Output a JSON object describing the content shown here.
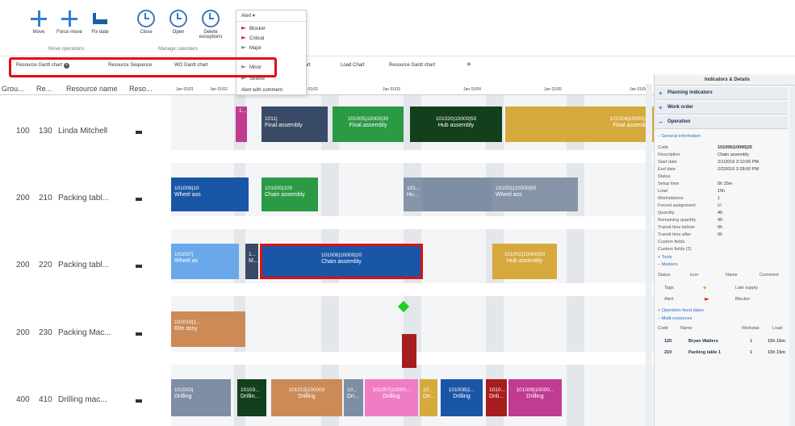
{
  "ribbon": {
    "buttons": [
      {
        "label": "Move",
        "icon": "move-icon"
      },
      {
        "label": "Force move",
        "icon": "force-move-icon"
      },
      {
        "label": "Fix date",
        "icon": "fix-date-icon"
      },
      {
        "label": "Close",
        "icon": "clock-icon"
      },
      {
        "label": "Open",
        "icon": "clock-icon"
      },
      {
        "label": "Delete exceptions",
        "icon": "clock-icon"
      }
    ],
    "groups": [
      "Move operations",
      "Manage calendars"
    ]
  },
  "alert_dropdown": {
    "header": "Alert",
    "items": [
      "Blocker",
      "Critical",
      "Major",
      "Minor",
      "Severe"
    ],
    "footer": "Alert with comment"
  },
  "tabs": [
    "Resource Gantt chart",
    "Resource Sequence",
    "WO Gantt chart",
    "Chart",
    "Load Chart",
    "Resource Gantt chart"
  ],
  "grid_header": {
    "group": "Grou...",
    "resource": "Re...",
    "resource_name": "Resource name",
    "reso": "Reso..."
  },
  "dates": [
    "Jan 01/01",
    "Jan 01/02",
    "Jan 01/02",
    "Jan 01/03",
    "Jan 01/04",
    "Jan 01/05",
    "Jan 01/06"
  ],
  "rows": [
    {
      "group": "100",
      "resource": "130",
      "name": "Linda Mitchell"
    },
    {
      "group": "200",
      "resource": "210",
      "name": "Packing tabl..."
    },
    {
      "group": "200",
      "resource": "220",
      "name": "Packing tabl..."
    },
    {
      "group": "200",
      "resource": "230",
      "name": "Packing Mac..."
    },
    {
      "group": "400",
      "resource": "410",
      "name": "Drilling mac..."
    }
  ],
  "bars": {
    "r0": [
      {
        "id": "1...",
        "label": ""
      },
      {
        "id": "1011|",
        "label": "Final assembly"
      },
      {
        "id": "101005|10000|30",
        "label": "Final assembly"
      },
      {
        "id": "101020|10000|50",
        "label": "Hub assembly"
      },
      {
        "id": "101004|10000|30",
        "label": "Final assembly"
      }
    ],
    "r1": [
      {
        "id": "101006|10",
        "label": "Wheel ass"
      },
      {
        "id": "101005|100",
        "label": "Chain assembly"
      },
      {
        "id": "101...",
        "label": "Hu..."
      },
      {
        "id": "101001|10000|50",
        "label": "Wheel ass"
      }
    ],
    "r2": [
      {
        "id": "101007|",
        "label": "Wheel as"
      },
      {
        "id": "1...",
        "label": "M..."
      },
      {
        "id": "101006|10000|20",
        "label": "Chain assembly"
      },
      {
        "id": "101002|10000|50",
        "label": "Hub assembly"
      }
    ],
    "r3": [
      {
        "id": "101019|1...",
        "label": "Rim assy"
      }
    ],
    "r4": [
      {
        "id": "101003|",
        "label": "Drilling"
      },
      {
        "id": "10103...",
        "label": "Drillin..."
      },
      {
        "id": "101015|100003",
        "label": "Drilling"
      },
      {
        "id": "10...",
        "label": "Dri..."
      },
      {
        "id": "101007|10000...",
        "label": "Drilling"
      },
      {
        "id": "10...",
        "label": "Dri..."
      },
      {
        "id": "101008|1...",
        "label": "Drilling"
      },
      {
        "id": "1010...",
        "label": "Drili..."
      },
      {
        "id": "101008|10000...",
        "label": "Drilling"
      }
    ]
  },
  "panel": {
    "title": "Indicators & Details",
    "sections": [
      "Planning indicators",
      "Work order",
      "Operation"
    ],
    "general_info": "General information",
    "fields": [
      {
        "k": "Code",
        "v": "101006|10000|20"
      },
      {
        "k": "Description",
        "v": "Chain assembly"
      },
      {
        "k": "Start date",
        "v": "2/1/2016 3:10:00 PM"
      },
      {
        "k": "End date",
        "v": "2/2/2016 3:28:00 PM"
      },
      {
        "k": "Status",
        "v": ""
      },
      {
        "k": "Setup time",
        "v": "0h 15m"
      },
      {
        "k": "Load",
        "v": "15h"
      },
      {
        "k": "Workstations",
        "v": "1"
      },
      {
        "k": "Forced assignment",
        "v": "☑"
      },
      {
        "k": "Quantity",
        "v": "40"
      },
      {
        "k": "Remaining quantity",
        "v": "40"
      },
      {
        "k": "Transit time before",
        "v": "0h"
      },
      {
        "k": "Transit time after",
        "v": "0h"
      },
      {
        "k": "Custom fields",
        "v": ""
      },
      {
        "k": "Custom fields (2)",
        "v": ""
      }
    ],
    "tools": "Tools",
    "markers": "Markers",
    "markers_header": [
      "Status",
      "Icon",
      "Name",
      "Comment"
    ],
    "markers_rows": [
      {
        "status": "Tags",
        "name": "Late supply"
      },
      {
        "status": "Alert",
        "name": "Blocker"
      }
    ],
    "fixed_dates": "Operation fixed dates",
    "multi_resources": "Multi-resources",
    "res_header": [
      "Code",
      "Name",
      "Workstat",
      "Load"
    ],
    "res_rows": [
      {
        "code": "120",
        "name": "Bryan Walters",
        "ws": "1",
        "load": "15h 15m"
      },
      {
        "code": "210",
        "name": "Packing table 1",
        "ws": "1",
        "load": "15h 15m"
      }
    ]
  }
}
